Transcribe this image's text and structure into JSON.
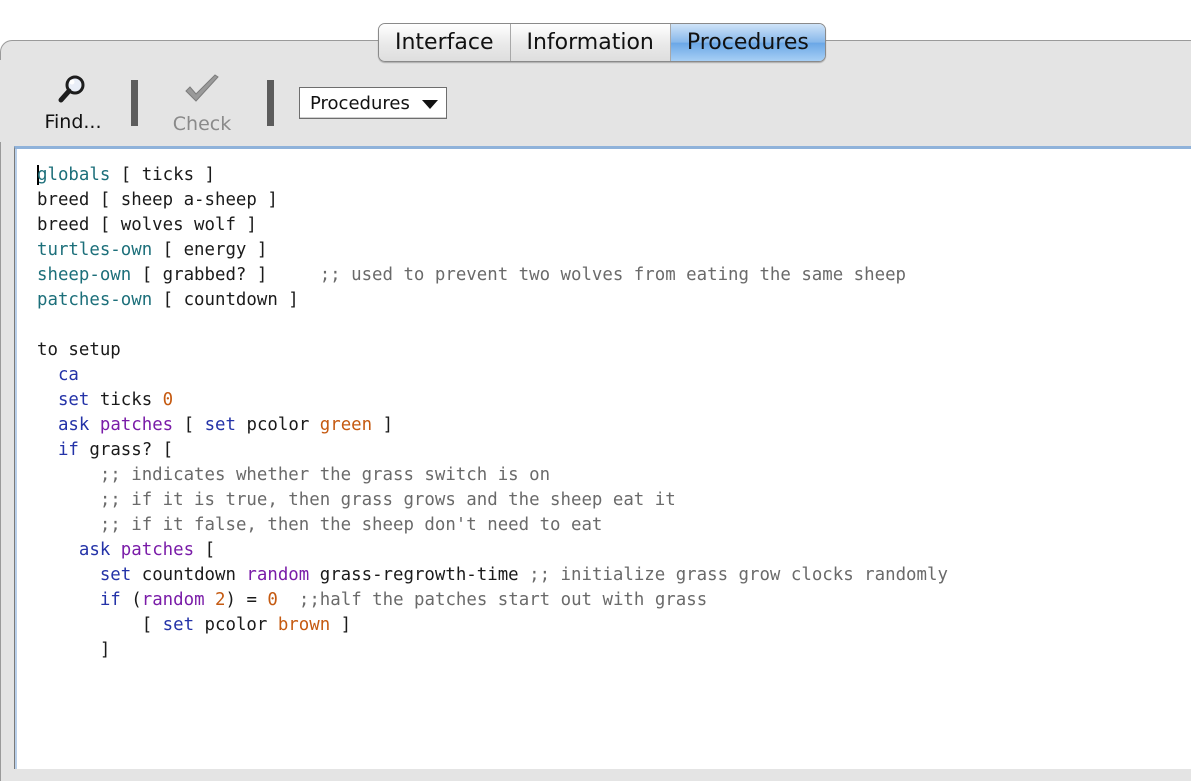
{
  "tabs": [
    {
      "label": "Interface",
      "active": false
    },
    {
      "label": "Information",
      "active": false
    },
    {
      "label": "Procedures",
      "active": true
    }
  ],
  "toolbar": {
    "find_label": "Find...",
    "check_label": "Check",
    "procedures_select": "Procedures"
  },
  "icons": {
    "find": "magnifier-icon",
    "check": "checkmark-icon",
    "dropdown": "triangle-down-icon"
  },
  "colors": {
    "tab_active": "#86b7ea",
    "keyword": "#1c6f7a",
    "comment": "#6a6a6a",
    "primitive": "#2433a8",
    "reporter": "#7a1ca8",
    "number": "#c55a11"
  },
  "code_lines": [
    [
      [
        "k",
        "globals"
      ],
      [
        "p",
        " [ ticks ]"
      ]
    ],
    [
      [
        "p",
        "breed [ sheep a-sheep ]"
      ]
    ],
    [
      [
        "p",
        "breed [ wolves wolf ]"
      ]
    ],
    [
      [
        "k",
        "turtles-own"
      ],
      [
        "p",
        " [ energy ]"
      ]
    ],
    [
      [
        "k",
        "sheep-own"
      ],
      [
        "p",
        " [ grabbed? ]     "
      ],
      [
        "c",
        ";; used to prevent two wolves from eating the same sheep"
      ]
    ],
    [
      [
        "k",
        "patches-own"
      ],
      [
        "p",
        " [ countdown ]"
      ]
    ],
    [
      [
        "p",
        ""
      ]
    ],
    [
      [
        "p",
        "to setup"
      ]
    ],
    [
      [
        "p",
        "  "
      ],
      [
        "prim",
        "ca"
      ]
    ],
    [
      [
        "p",
        "  "
      ],
      [
        "prim",
        "set"
      ],
      [
        "p",
        " ticks "
      ],
      [
        "n",
        "0"
      ]
    ],
    [
      [
        "p",
        "  "
      ],
      [
        "prim",
        "ask"
      ],
      [
        "p",
        " "
      ],
      [
        "rep",
        "patches"
      ],
      [
        "p",
        " [ "
      ],
      [
        "prim",
        "set"
      ],
      [
        "p",
        " pcolor "
      ],
      [
        "n",
        "green"
      ],
      [
        "p",
        " ]"
      ]
    ],
    [
      [
        "p",
        "  "
      ],
      [
        "prim",
        "if"
      ],
      [
        "p",
        " grass? ["
      ]
    ],
    [
      [
        "p",
        "      "
      ],
      [
        "c",
        ";; indicates whether the grass switch is on"
      ]
    ],
    [
      [
        "p",
        "      "
      ],
      [
        "c",
        ";; if it is true, then grass grows and the sheep eat it"
      ]
    ],
    [
      [
        "p",
        "      "
      ],
      [
        "c",
        ";; if it false, then the sheep don't need to eat"
      ]
    ],
    [
      [
        "p",
        "    "
      ],
      [
        "prim",
        "ask"
      ],
      [
        "p",
        " "
      ],
      [
        "rep",
        "patches"
      ],
      [
        "p",
        " ["
      ]
    ],
    [
      [
        "p",
        "      "
      ],
      [
        "prim",
        "set"
      ],
      [
        "p",
        " countdown "
      ],
      [
        "rep",
        "random"
      ],
      [
        "p",
        " grass-regrowth-time "
      ],
      [
        "c",
        ";; initialize grass grow clocks randomly"
      ]
    ],
    [
      [
        "p",
        "      "
      ],
      [
        "prim",
        "if"
      ],
      [
        "p",
        " ("
      ],
      [
        "rep",
        "random"
      ],
      [
        "p",
        " "
      ],
      [
        "n",
        "2"
      ],
      [
        "p",
        ") = "
      ],
      [
        "n",
        "0"
      ],
      [
        "p",
        "  "
      ],
      [
        "c",
        ";;half the patches start out with grass"
      ]
    ],
    [
      [
        "p",
        "          [ "
      ],
      [
        "prim",
        "set"
      ],
      [
        "p",
        " pcolor "
      ],
      [
        "n",
        "brown"
      ],
      [
        "p",
        " ]"
      ]
    ],
    [
      [
        "p",
        "      ]"
      ]
    ]
  ]
}
